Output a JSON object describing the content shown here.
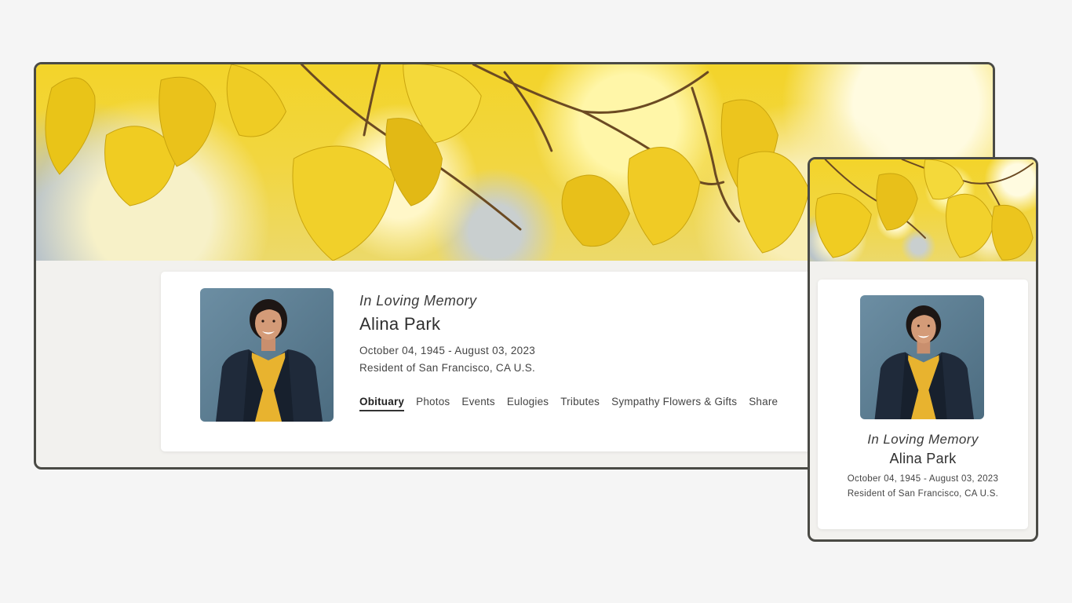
{
  "profile": {
    "tagline": "In Loving Memory",
    "name": "Alina Park",
    "dates": "October 04, 1945 - August 03, 2023",
    "residence": "Resident of San Francisco, CA U.S.",
    "photo_icon": "portrait-photo"
  },
  "tabs": [
    {
      "label": "Obituary",
      "active": true
    },
    {
      "label": "Photos",
      "active": false
    },
    {
      "label": "Events",
      "active": false
    },
    {
      "label": "Eulogies",
      "active": false
    },
    {
      "label": "Tributes",
      "active": false
    },
    {
      "label": "Sympathy Flowers & Gifts",
      "active": false
    },
    {
      "label": "Share",
      "active": false
    }
  ],
  "colors": {
    "frame_border": "#4a4a45",
    "page_background": "#f2f1ee",
    "leaf_yellow": "#f2d22c",
    "blazer": "#1f2a3a",
    "shirt": "#e8b32f",
    "photo_background": "#5f7f93"
  }
}
